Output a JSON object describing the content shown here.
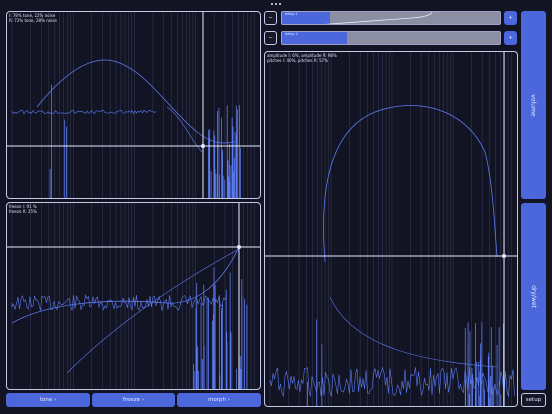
{
  "panels": {
    "tone": {
      "readout_l": "l: 78% tone, 22% noise",
      "readout_r": "R: 72% tone, 28% noise"
    },
    "freeze": {
      "readout_l": "freeze l: 91 %",
      "readout_r": "freeze R: 25%"
    },
    "amplitude": {
      "readout_1": "amplitude l: 6%, amplitude R: 98%",
      "readout_2": "pitches l: 40%, pitches R: 57%"
    }
  },
  "delays": [
    {
      "label": "delay 1",
      "minus": "−",
      "plus": "+",
      "level": 0.2
    },
    {
      "label": "delay 2",
      "minus": "−",
      "plus": "+",
      "level": 0.29
    }
  ],
  "buttons": {
    "tone": "tone ›",
    "freeze": "freeze ›",
    "morph": "morph ›",
    "volume": "volume",
    "drywet": "dry/wet",
    "setup": "setup"
  },
  "colors": {
    "accent": "#4b67db",
    "trace": "#5d7cf2",
    "background": "#131423"
  }
}
